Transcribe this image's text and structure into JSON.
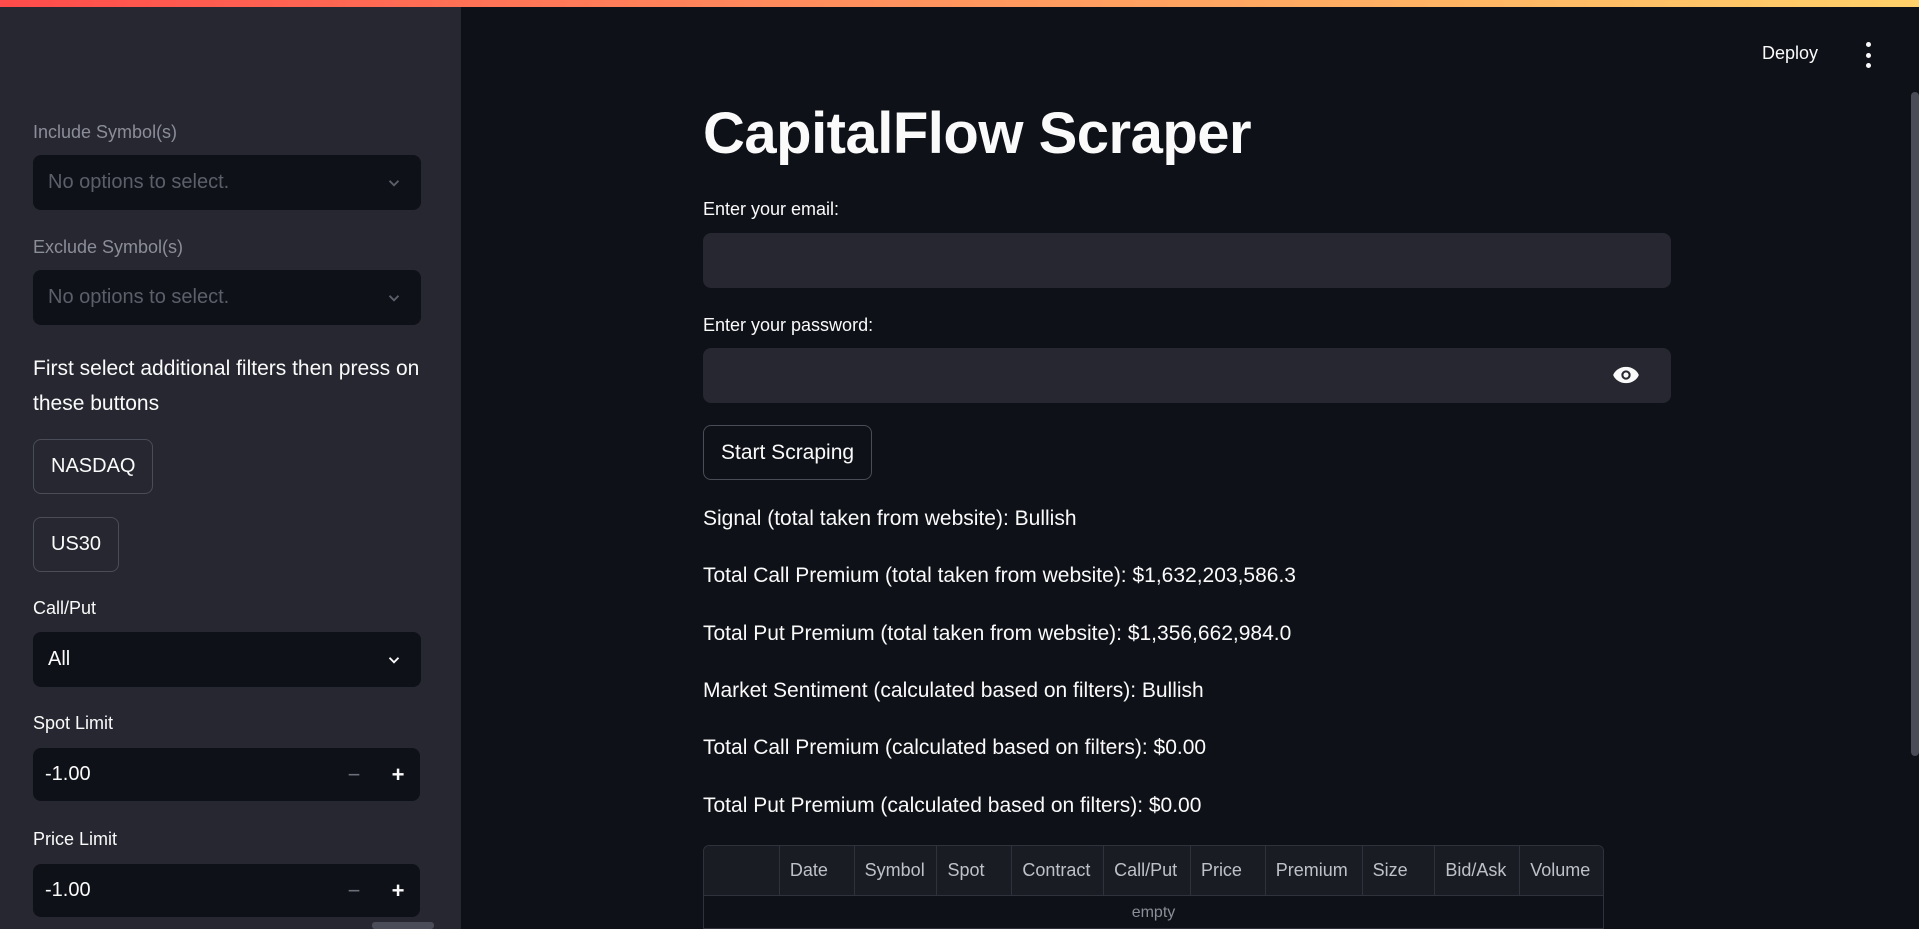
{
  "header": {
    "deploy_label": "Deploy",
    "menu_icon": "kebab-menu-icon"
  },
  "sidebar": {
    "include_label": "Include Symbol(s)",
    "include_placeholder": "No options to select.",
    "exclude_label": "Exclude Symbol(s)",
    "exclude_placeholder": "No options to select.",
    "instruction": "First select additional filters then press on these buttons",
    "buttons": [
      "NASDAQ",
      "US30"
    ],
    "callput_label": "Call/Put",
    "callput_value": "All",
    "spot_label": "Spot Limit",
    "spot_value": "-1.00",
    "price_label": "Price Limit",
    "price_value": "-1.00",
    "minus": "−",
    "plus": "+"
  },
  "main": {
    "title": "CapitalFlow Scraper",
    "email_label": "Enter your email:",
    "email_value": "",
    "password_label": "Enter your password:",
    "password_value": "",
    "start_button": "Start Scraping",
    "results": [
      "Signal (total taken from website): Bullish",
      "Total Call Premium (total taken from website): $1,632,203,586.3",
      "Total Put Premium (total taken from website): $1,356,662,984.0",
      "Market Sentiment (calculated based on filters): Bullish",
      "Total Call Premium (calculated based on filters): $0.00",
      "Total Put Premium (calculated based on filters): $0.00"
    ],
    "table": {
      "columns": [
        "",
        "Date",
        "Symbol",
        "Spot",
        "Contract",
        "Call/Put",
        "Price",
        "Premium",
        "Size",
        "Bid/Ask",
        "Volume"
      ],
      "empty_text": "empty"
    }
  }
}
